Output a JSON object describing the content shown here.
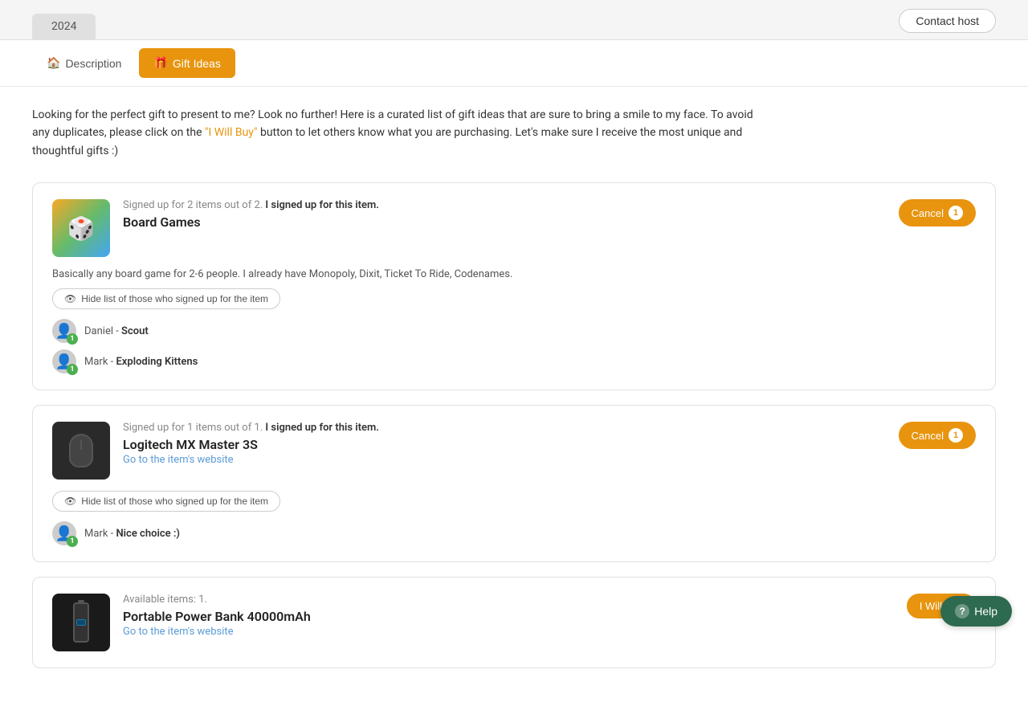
{
  "header": {
    "year": "2024",
    "contact_host_label": "Contact host"
  },
  "tabs": [
    {
      "id": "description",
      "label": "Description",
      "icon": "🏠",
      "active": false
    },
    {
      "id": "gift-ideas",
      "label": "Gift Ideas",
      "icon": "🎁",
      "active": true
    }
  ],
  "intro": {
    "text_before": "Looking for the perfect gift to present to me? Look no further! Here is a curated list of gift ideas that are sure to bring a smile to my face. To avoid any duplicates, please click on the ",
    "highlight": "\"I Will Buy\"",
    "text_after": " button to let others know what you are purchasing. Let's make sure I receive the most unique and thoughtful gifts :)"
  },
  "gifts": [
    {
      "id": "board-games",
      "status": "Signed up for 2 items out of 2.",
      "status_suffix": "I signed up for this item.",
      "title": "Board Games",
      "description": "Basically any board game for 2-6 people. I already have Monopoly, Dixit, Ticket To Ride, Codenames.",
      "link": null,
      "action": "Cancel",
      "action_count": "1",
      "hide_label": "Hide list of those who signed up for the item",
      "signups": [
        {
          "name": "Daniel",
          "item": "Scout",
          "badge": "1"
        },
        {
          "name": "Mark",
          "item": "Exploding Kittens",
          "badge": "1"
        }
      ]
    },
    {
      "id": "logitech-mx",
      "status": "Signed up for 1 items out of 1.",
      "status_suffix": "I signed up for this item.",
      "title": "Logitech MX Master 3S",
      "description": null,
      "link": "Go to the item's website",
      "action": "Cancel",
      "action_count": "1",
      "hide_label": "Hide list of those who signed up for the item",
      "signups": [
        {
          "name": "Mark",
          "item": "Nice choice :)",
          "badge": "1"
        }
      ]
    },
    {
      "id": "power-bank",
      "status": "Available items: 1.",
      "status_suffix": null,
      "title": "Portable Power Bank 40000mAh",
      "description": null,
      "link": "Go to the item's website",
      "action": "I Will Buy",
      "action_count": null,
      "hide_label": null,
      "signups": []
    }
  ],
  "help_button": "Help"
}
